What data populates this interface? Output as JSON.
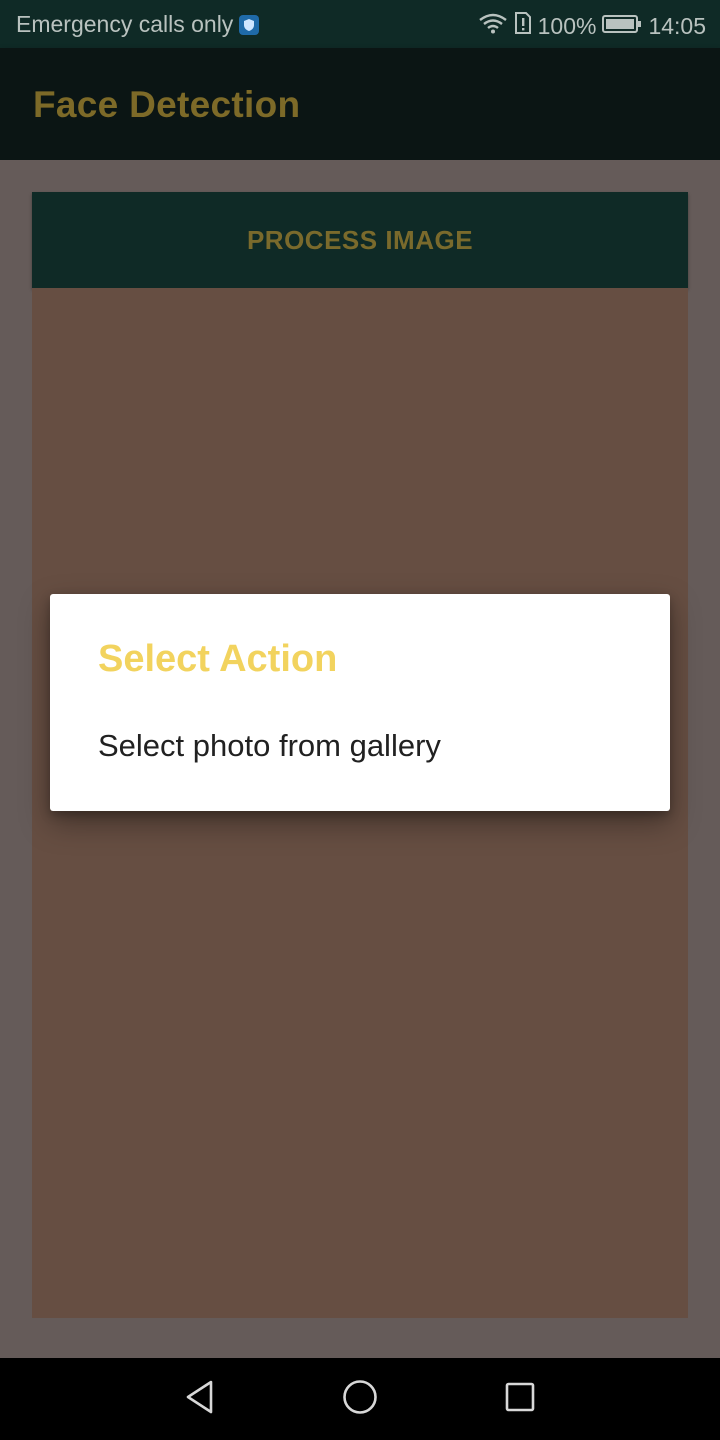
{
  "status_bar": {
    "carrier_text": "Emergency calls only",
    "battery_percent": "100%",
    "time": "14:05",
    "icons": [
      "shield-icon",
      "wifi-icon",
      "sim-alert-icon",
      "battery-icon"
    ]
  },
  "app_bar": {
    "title": "Face Detection"
  },
  "main": {
    "process_button_label": "PROCESS IMAGE"
  },
  "dialog": {
    "title": "Select Action",
    "items": [
      {
        "label": "Select photo from gallery"
      }
    ]
  },
  "nav_bar": {
    "icons": [
      "back-icon",
      "home-icon",
      "recents-icon"
    ]
  },
  "colors": {
    "status_bar": "#0f2a26",
    "app_bar": "#0b1514",
    "title_text": "#7d6a28",
    "dialog_title": "#f2d35e",
    "image_area": "#664e42",
    "dim_background": "#655b59"
  }
}
